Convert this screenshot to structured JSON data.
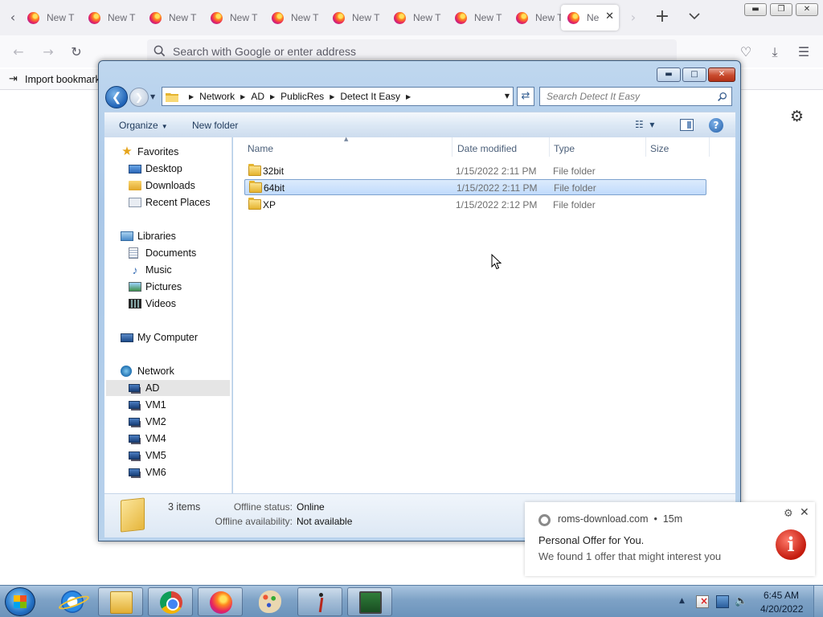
{
  "browser": {
    "tabs": [
      {
        "label": "New T"
      },
      {
        "label": "New T"
      },
      {
        "label": "New T"
      },
      {
        "label": "New T"
      },
      {
        "label": "New T"
      },
      {
        "label": "New T"
      },
      {
        "label": "New T"
      },
      {
        "label": "New T"
      },
      {
        "label": "New T"
      },
      {
        "label": "Ne",
        "active": true
      }
    ],
    "url_placeholder": "Search with Google or enter address",
    "bookmarks_bar": {
      "import_label": "Import bookmarks..."
    }
  },
  "explorer": {
    "breadcrumb": [
      "Network",
      "AD",
      "PublicRes",
      "Detect It Easy"
    ],
    "search_placeholder": "Search Detect It Easy",
    "toolbar": {
      "organize_label": "Organize",
      "new_folder_label": "New folder"
    },
    "nav": {
      "favorites": {
        "label": "Favorites",
        "items": [
          "Desktop",
          "Downloads",
          "Recent Places"
        ]
      },
      "libraries": {
        "label": "Libraries",
        "items": [
          "Documents",
          "Music",
          "Pictures",
          "Videos"
        ]
      },
      "computer": {
        "label": "My Computer"
      },
      "network": {
        "label": "Network",
        "items": [
          "AD",
          "VM1",
          "VM2",
          "VM4",
          "VM5",
          "VM6"
        ],
        "selected": "AD"
      }
    },
    "columns": [
      "Name",
      "Date modified",
      "Type",
      "Size"
    ],
    "files": [
      {
        "name": "32bit",
        "date": "1/15/2022 2:11 PM",
        "type": "File folder"
      },
      {
        "name": "64bit",
        "date": "1/15/2022 2:11 PM",
        "type": "File folder",
        "selected": true
      },
      {
        "name": "XP",
        "date": "1/15/2022 2:12 PM",
        "type": "File folder"
      }
    ],
    "details": {
      "count": "3 items",
      "offline_status_label": "Offline status:",
      "offline_status_value": "Online",
      "offline_availability_label": "Offline availability:",
      "offline_availability_value": "Not available"
    }
  },
  "notification": {
    "source": "roms-download.com",
    "age": "15m",
    "title": "Personal Offer for You.",
    "body": "We found 1 offer that might interest you"
  },
  "taskbar": {
    "apps": [
      "internet-explorer",
      "windows-explorer",
      "chrome",
      "firefox",
      "paint",
      "stick-figure-app",
      "system-monitor"
    ],
    "clock_time": "6:45 AM",
    "clock_date": "4/20/2022"
  }
}
